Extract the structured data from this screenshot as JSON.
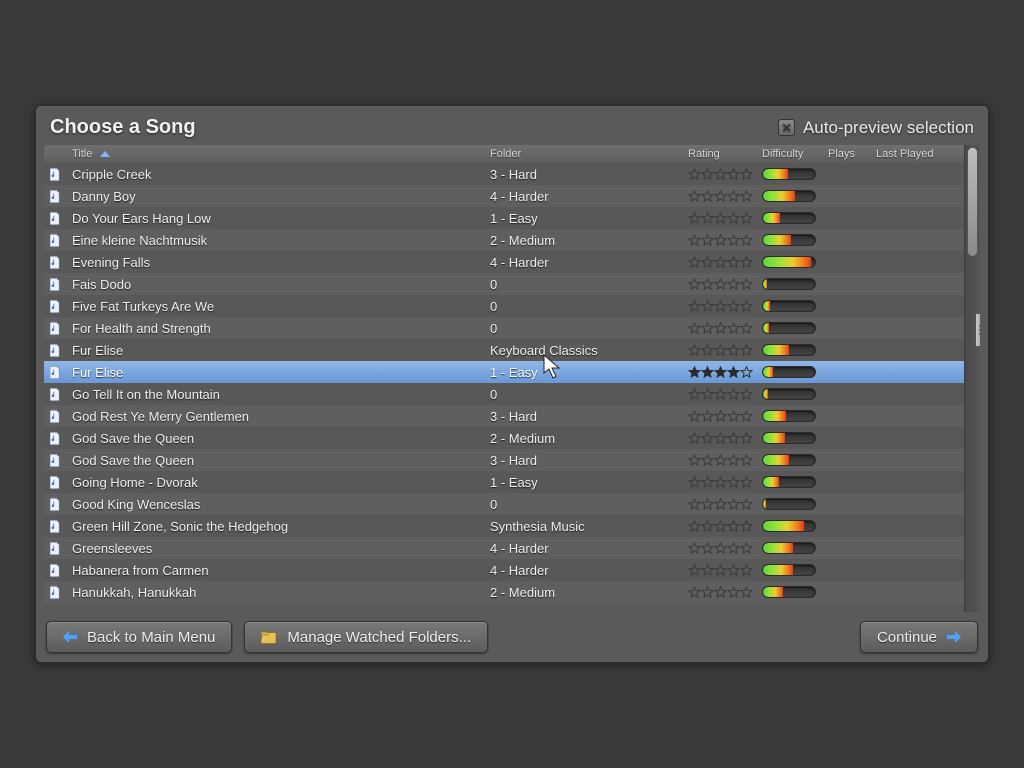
{
  "title": "Choose a Song",
  "auto_preview_label": "Auto-preview selection",
  "columns": {
    "title": "Title",
    "folder": "Folder",
    "rating": "Rating",
    "difficulty": "Difficulty",
    "plays": "Plays",
    "last_played": "Last Played"
  },
  "buttons": {
    "back": "Back to Main Menu",
    "manage": "Manage Watched Folders...",
    "continue": "Continue"
  },
  "selected_index": 8,
  "songs": [
    {
      "title": "Cripple Creek",
      "folder": "3 - Hard",
      "rating": 0,
      "difficulty": 0.48
    },
    {
      "title": "Danny Boy",
      "folder": "4 - Harder",
      "rating": 0,
      "difficulty": 0.62
    },
    {
      "title": "Do Your Ears Hang Low",
      "folder": "1 - Easy",
      "rating": 0,
      "difficulty": 0.32
    },
    {
      "title": "Eine kleine Nachtmusik",
      "folder": "2 - Medium",
      "rating": 0,
      "difficulty": 0.54
    },
    {
      "title": "Evening Falls",
      "folder": "4 - Harder",
      "rating": 0,
      "difficulty": 0.92
    },
    {
      "title": "Fais Dodo",
      "folder": "0",
      "rating": 0,
      "difficulty": 0.08
    },
    {
      "title": "Five Fat Turkeys Are We",
      "folder": "0",
      "rating": 0,
      "difficulty": 0.14
    },
    {
      "title": "For Health and Strength",
      "folder": "0",
      "rating": 0,
      "difficulty": 0.12
    },
    {
      "title": "Fur Elise",
      "folder": "Keyboard Classics",
      "rating": 0,
      "difficulty": 0.5
    },
    {
      "title": "Fur Elise",
      "folder": "1 - Easy",
      "rating": 4,
      "difficulty": 0.2
    },
    {
      "title": "Go Tell It on the Mountain",
      "folder": "0",
      "rating": 0,
      "difficulty": 0.1
    },
    {
      "title": "God Rest Ye Merry Gentlemen",
      "folder": "3 - Hard",
      "rating": 0,
      "difficulty": 0.44
    },
    {
      "title": "God Save the Queen",
      "folder": "2 - Medium",
      "rating": 0,
      "difficulty": 0.42
    },
    {
      "title": "God Save the Queen",
      "folder": "3 - Hard",
      "rating": 0,
      "difficulty": 0.5
    },
    {
      "title": "Going Home - Dvorak",
      "folder": "1 - Easy",
      "rating": 0,
      "difficulty": 0.3
    },
    {
      "title": "Good King Wenceslas",
      "folder": "0",
      "rating": 0,
      "difficulty": 0.06
    },
    {
      "title": "Green Hill Zone, Sonic the Hedgehog",
      "folder": "Synthesia Music",
      "rating": 0,
      "difficulty": 0.78
    },
    {
      "title": "Greensleeves",
      "folder": "4 - Harder",
      "rating": 0,
      "difficulty": 0.58
    },
    {
      "title": "Habanera from Carmen",
      "folder": "4 - Harder",
      "rating": 0,
      "difficulty": 0.58
    },
    {
      "title": "Hanukkah, Hanukkah",
      "folder": "2 - Medium",
      "rating": 0,
      "difficulty": 0.38
    }
  ]
}
